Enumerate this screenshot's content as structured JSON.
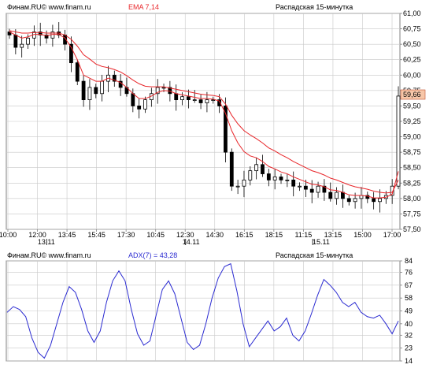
{
  "top_panel": {
    "source": "Финам.RU© www.finam.ru",
    "indicator_label": "EMA 7,14",
    "subtitle": "Распадская 15-минутка",
    "last_price_label": "59,66"
  },
  "bottom_panel": {
    "source": "Финам.RU© www.finam.ru",
    "indicator_label": "ADX(7) = 43,28",
    "subtitle": "Распадская 15-минутка"
  },
  "colors": {
    "ema": "#e8262a",
    "adx": "#2b2bd1",
    "label_red": "#e8262a",
    "label_blue": "#2b2bd1",
    "price_box": "#f7c7a9",
    "grid": "#c8c8c8",
    "candle": "#000000"
  },
  "chart_data": [
    {
      "type": "candlestick",
      "title": "Распадская 15-минутка",
      "ylim": [
        57.5,
        61.0
      ],
      "y_ticks": [
        "61,00",
        "60,75",
        "60,50",
        "60,25",
        "60,00",
        "59,75",
        "59,50",
        "59,25",
        "59,00",
        "58,75",
        "58,50",
        "58,25",
        "58,00",
        "57,75",
        "57,50"
      ],
      "time_ticks": [
        "10:00",
        "12:00",
        "13:45",
        "15:45",
        "17:30",
        "10:45",
        "12:30",
        "14:30",
        "16:15",
        "18:15",
        "11:15",
        "13:15",
        "15:00",
        "17:00"
      ],
      "date_labels": [
        "13.11",
        "14.11",
        "15.11"
      ],
      "close": [
        60.65,
        60.45,
        60.5,
        60.6,
        60.7,
        60.65,
        60.6,
        60.7,
        60.65,
        60.5,
        60.2,
        59.9,
        59.6,
        59.8,
        59.7,
        59.9,
        60.0,
        59.9,
        59.8,
        59.7,
        59.5,
        59.45,
        59.6,
        59.7,
        59.8,
        59.8,
        59.7,
        59.6,
        59.65,
        59.6,
        59.6,
        59.55,
        59.6,
        59.6,
        59.5,
        58.75,
        58.2,
        58.2,
        58.3,
        58.45,
        58.55,
        58.4,
        58.3,
        58.35,
        58.3,
        58.3,
        58.2,
        58.2,
        58.15,
        58.1,
        58.2,
        58.1,
        58.0,
        58.1,
        58.0,
        57.95,
        58.0,
        58.05,
        58.0,
        57.95,
        58.0,
        58.05,
        58.2,
        59.66
      ],
      "ema_fast": [
        60.7,
        60.65,
        60.6,
        60.62,
        60.66,
        60.66,
        60.64,
        60.66,
        60.66,
        60.6,
        60.45,
        60.25,
        60.0,
        59.95,
        59.9,
        59.9,
        59.95,
        59.92,
        59.88,
        59.8,
        59.7,
        59.62,
        59.62,
        59.66,
        59.72,
        59.75,
        59.74,
        59.7,
        59.68,
        59.66,
        59.64,
        59.62,
        59.62,
        59.61,
        59.58,
        59.38,
        59.1,
        58.9,
        58.76,
        58.69,
        58.66,
        58.6,
        58.52,
        58.48,
        58.43,
        58.4,
        58.35,
        58.31,
        58.27,
        58.23,
        58.22,
        58.19,
        58.14,
        58.13,
        58.1,
        58.06,
        58.05,
        58.05,
        58.04,
        58.01,
        58.01,
        58.02,
        58.07,
        58.44
      ],
      "ema_slow": [
        60.72,
        60.7,
        60.68,
        60.68,
        60.69,
        60.69,
        60.68,
        60.68,
        60.68,
        60.65,
        60.58,
        60.47,
        60.33,
        60.26,
        60.18,
        60.14,
        60.12,
        60.09,
        60.05,
        59.99,
        59.92,
        59.86,
        59.82,
        59.81,
        59.81,
        59.81,
        59.79,
        59.77,
        59.75,
        59.73,
        59.71,
        59.69,
        59.68,
        59.67,
        59.65,
        59.53,
        59.35,
        59.21,
        59.1,
        59.03,
        58.97,
        58.9,
        58.82,
        58.77,
        58.71,
        58.66,
        58.6,
        58.55,
        58.5,
        58.45,
        58.42,
        58.38,
        58.33,
        58.3,
        58.26,
        58.22,
        58.19,
        58.17,
        58.15,
        58.12,
        58.1,
        58.09,
        58.1,
        58.3
      ]
    },
    {
      "type": "line",
      "title": "ADX(7) = 43,28",
      "ylim": [
        14,
        84
      ],
      "y_ticks": [
        "84",
        "76",
        "67",
        "58",
        "49",
        "40",
        "32",
        "23",
        "14"
      ],
      "series": [
        {
          "name": "ADX(7)",
          "values": [
            48,
            52,
            50,
            45,
            30,
            20,
            16,
            25,
            40,
            55,
            66,
            62,
            50,
            35,
            27,
            35,
            55,
            70,
            77,
            70,
            50,
            33,
            25,
            28,
            46,
            64,
            70,
            61,
            44,
            27,
            22,
            25,
            40,
            58,
            72,
            80,
            82,
            63,
            40,
            24,
            30,
            36,
            42,
            35,
            38,
            44,
            32,
            28,
            35,
            47,
            60,
            71,
            67,
            62,
            55,
            52,
            55,
            48,
            45,
            44,
            46,
            40,
            33,
            42
          ]
        }
      ]
    }
  ]
}
